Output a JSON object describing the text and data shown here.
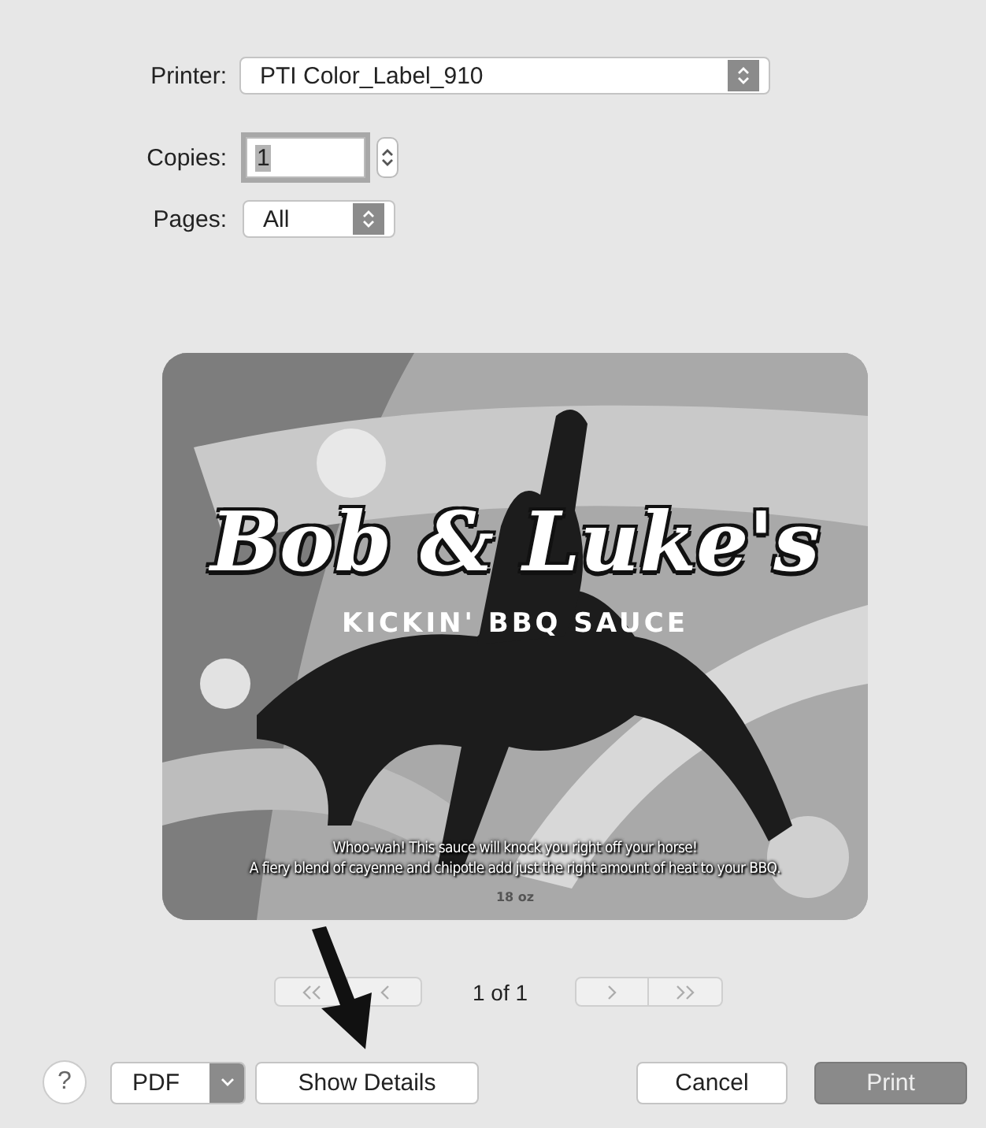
{
  "printer": {
    "label": "Printer:",
    "value": "PTI Color_Label_910"
  },
  "copies": {
    "label": "Copies:",
    "value": "1",
    "focused": true
  },
  "pages": {
    "label": "Pages:",
    "value": "All"
  },
  "preview": {
    "title": "Bob & Luke's",
    "subtitle": "KICKIN' BBQ SAUCE",
    "lines": [
      "Whoo-wah! This sauce will knock you right off your horse!",
      "A fiery blend of cayenne and chipotle add just the right amount of heat to your BBQ."
    ],
    "size": "18 oz"
  },
  "page_nav": [
    {
      "kind": "first",
      "disabled": true
    },
    {
      "kind": "previous",
      "disabled": true
    },
    {
      "kind": "indicator",
      "label": "1 of 1"
    },
    {
      "kind": "next",
      "disabled": true
    },
    {
      "kind": "last",
      "disabled": true
    }
  ],
  "buttons": [
    {
      "kind": "help",
      "label": "?"
    },
    {
      "kind": "menu",
      "label": "PDF"
    },
    {
      "kind": "plain",
      "label": "Show Details"
    },
    {
      "kind": "plain",
      "label": "Cancel"
    },
    {
      "kind": "default",
      "label": "Print"
    }
  ]
}
